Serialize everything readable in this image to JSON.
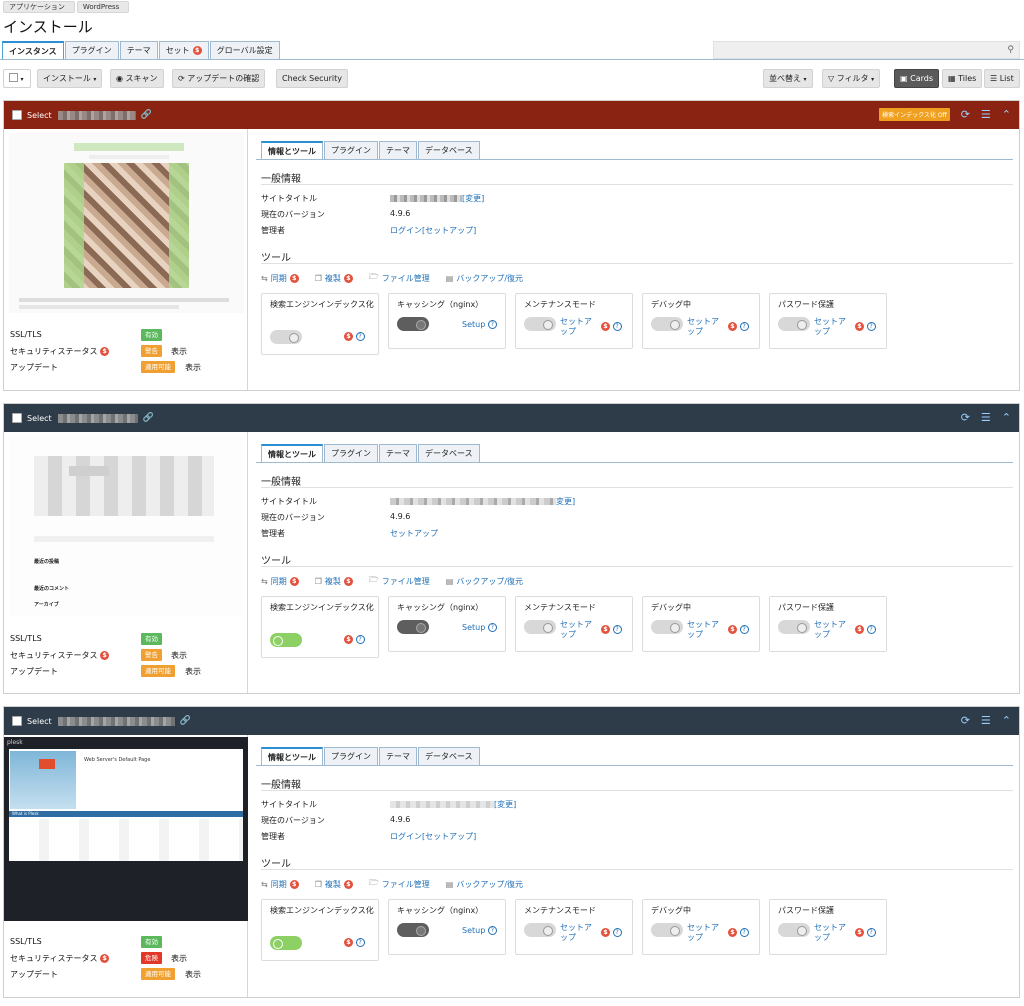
{
  "breadcrumb": [
    "アプリケーション",
    "WordPress"
  ],
  "page_title": "インストール",
  "tabs": [
    {
      "label": "インスタンス",
      "active": true
    },
    {
      "label": "プラグイン"
    },
    {
      "label": "テーマ"
    },
    {
      "label": "セット",
      "badge": "$"
    },
    {
      "label": "グローバル設定"
    }
  ],
  "toolbar": {
    "install": "インストール",
    "scan": "スキャン",
    "check_updates": "アップデートの確認",
    "check_security": "Check Security",
    "sort": "並べ替え",
    "filter": "フィルタ",
    "cards": "Cards",
    "tiles": "Tiles",
    "list": "List"
  },
  "card_common": {
    "select": "Select",
    "inner_tabs": [
      "情報とツール",
      "プラグイン",
      "テーマ",
      "データベース"
    ],
    "general_info": "一般情報",
    "site_title": "サイトタイトル",
    "version_label": "現在のバージョン",
    "admin_label": "管理者",
    "tools_heading": "ツール",
    "tools": [
      "同期",
      "複製",
      "ファイル管理",
      "バックアップ/復元"
    ],
    "mini_titles": [
      "検索エンジンインデックス化",
      "キャッシング（nginx）",
      "メンテナンスモード",
      "デバッグ中",
      "パスワード保護"
    ],
    "setup_en": "Setup",
    "setup_jp": "セットアップ",
    "change": "変更",
    "login": "ログイン",
    "ssl": "SSL/TLS",
    "security": "セキュリティステータス",
    "update": "アップデート",
    "show": "表示",
    "dollar": "$",
    "question": "?"
  },
  "cards": [
    {
      "header_color": "#8b2312",
      "index_badge": "検索インデックス化 Off",
      "site_title_suffix": "[変更]",
      "version": "4.9.6",
      "admin_login": "ログイン",
      "admin_setup": "[セットアップ]",
      "ssl_status": "有効",
      "security_status": "警告",
      "update_status": "適用可能",
      "index_on": false
    },
    {
      "header_color": "#2e3b48",
      "site_title_suffix": "変更]",
      "version": "4.9.6",
      "admin_setup": "セットアップ",
      "ssl_status": "有効",
      "security_status": "警告",
      "update_status": "適用可能",
      "index_on": true,
      "sidebar": [
        "最近の投稿",
        "最近のコメント",
        "アーカイブ"
      ]
    },
    {
      "header_color": "#2e3b48",
      "site_title_suffix": "[変更]",
      "version": "4.9.6",
      "admin_login": "ログイン",
      "admin_setup": "[セットアップ]",
      "ssl_status": "有効",
      "security_status": "危険",
      "update_status": "適用可能",
      "index_on": true,
      "preview": {
        "brand": "plesk",
        "heading": "Web Server's Default Page",
        "whatis": "What is Plesk"
      }
    }
  ]
}
